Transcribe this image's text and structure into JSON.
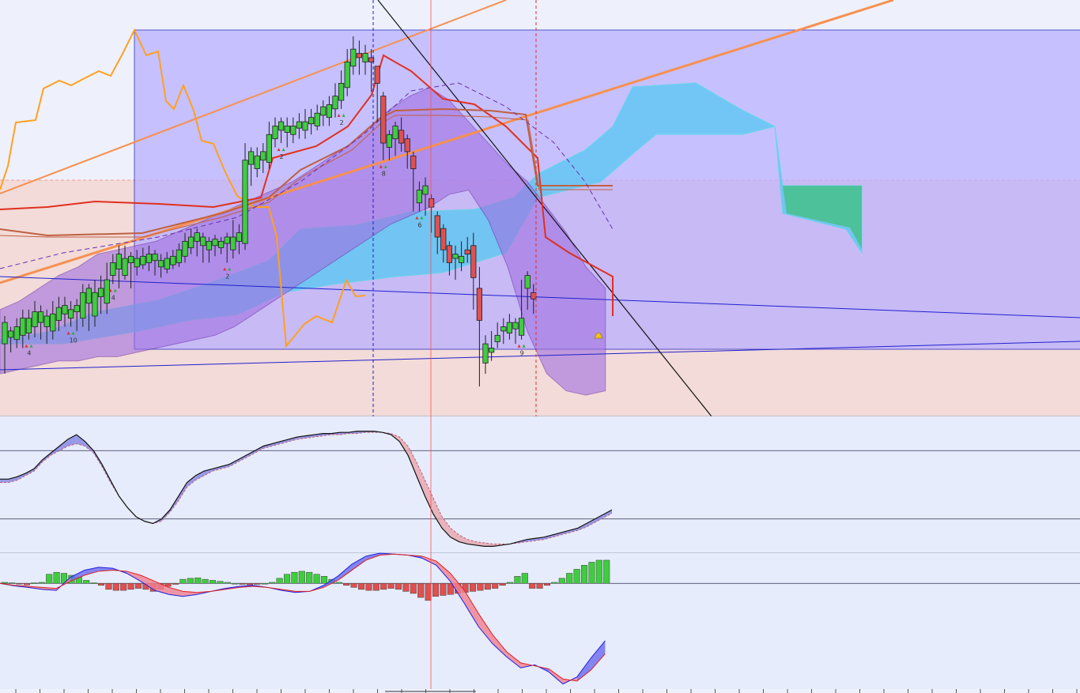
{
  "chart_data": [
    {
      "type": "candlestick",
      "panel": "price",
      "candles": [
        [
          314,
          324,
          317,
          327,
          300
        ],
        [
          317,
          320,
          316,
          322,
          310
        ],
        [
          316,
          322,
          318,
          326,
          312
        ],
        [
          318,
          326,
          319,
          330,
          312
        ],
        [
          319,
          326,
          322,
          330,
          316
        ],
        [
          322,
          329,
          324,
          334,
          317
        ],
        [
          324,
          329,
          322,
          332,
          316
        ],
        [
          322,
          327,
          320,
          330,
          314
        ],
        [
          320,
          328,
          325,
          334,
          316
        ],
        [
          325,
          331,
          328,
          336,
          320
        ],
        [
          328,
          332,
          326,
          336,
          322
        ],
        [
          326,
          330,
          329,
          334,
          322
        ],
        [
          329,
          332,
          326,
          335,
          320
        ],
        [
          326,
          338,
          333,
          342,
          322
        ],
        [
          333,
          340,
          327,
          342,
          320
        ],
        [
          327,
          338,
          336,
          344,
          322
        ],
        [
          336,
          340,
          333,
          346,
          328
        ],
        [
          333,
          344,
          346,
          352,
          328
        ],
        [
          346,
          352,
          349,
          356,
          342
        ],
        [
          349,
          356,
          346,
          360,
          340
        ],
        [
          346,
          354,
          352,
          360,
          344
        ],
        [
          352,
          355,
          350,
          357,
          340
        ],
        [
          350,
          354,
          351,
          358,
          346
        ],
        [
          351,
          355,
          352,
          359,
          349
        ],
        [
          352,
          356,
          353,
          360,
          348
        ],
        [
          353,
          356,
          350,
          358,
          346
        ],
        [
          350,
          353,
          349,
          356,
          345
        ],
        [
          349,
          354,
          351,
          357,
          347
        ],
        [
          351,
          355,
          352,
          358,
          349
        ],
        [
          352,
          358,
          355,
          361,
          350
        ],
        [
          355,
          362,
          359,
          366,
          352
        ],
        [
          359,
          364,
          362,
          368,
          356
        ],
        [
          362,
          366,
          360,
          368,
          355
        ],
        [
          360,
          364,
          358,
          366,
          352
        ],
        [
          358,
          362,
          360,
          364,
          352
        ],
        [
          360,
          363,
          359,
          365,
          355
        ],
        [
          359,
          362,
          361,
          364,
          356
        ],
        [
          361,
          364,
          358,
          366,
          352
        ],
        [
          358,
          364,
          362,
          372,
          354
        ],
        [
          362,
          366,
          361,
          370,
          356
        ],
        [
          361,
          400,
          398,
          408,
          358
        ],
        [
          398,
          404,
          396,
          406,
          388
        ],
        [
          396,
          402,
          400,
          406,
          392
        ],
        [
          400,
          404,
          399,
          408,
          394
        ],
        [
          399,
          412,
          410,
          418,
          396
        ],
        [
          410,
          416,
          414,
          420,
          406
        ],
        [
          414,
          418,
          413,
          420,
          408
        ],
        [
          413,
          416,
          412,
          420,
          406
        ],
        [
          412,
          416,
          415,
          420,
          408
        ],
        [
          415,
          418,
          414,
          422,
          410
        ],
        [
          414,
          418,
          417,
          424,
          410
        ],
        [
          417,
          420,
          416,
          424,
          412
        ],
        [
          416,
          422,
          421,
          426,
          414
        ],
        [
          421,
          425,
          420,
          428,
          416
        ],
        [
          420,
          426,
          424,
          430,
          416
        ],
        [
          424,
          430,
          428,
          436,
          420
        ],
        [
          428,
          436,
          434,
          442,
          424
        ],
        [
          434,
          446,
          444,
          452,
          430
        ],
        [
          444,
          452,
          450,
          458,
          440
        ],
        [
          450,
          448,
          446,
          456,
          440
        ],
        [
          446,
          450,
          448,
          454,
          440
        ],
        [
          448,
          446,
          444,
          452,
          432
        ],
        [
          444,
          436,
          430,
          440,
          418
        ],
        [
          430,
          408,
          406,
          432,
          400
        ],
        [
          406,
          412,
          410,
          414,
          400
        ],
        [
          410,
          416,
          414,
          418,
          402
        ],
        [
          414,
          408,
          410,
          420,
          404
        ],
        [
          410,
          404,
          402,
          412,
          396
        ],
        [
          402,
          396,
          380,
          404,
          376
        ],
        [
          380,
          386,
          384,
          390,
          376
        ],
        [
          384,
          388,
          382,
          392,
          374
        ],
        [
          382,
          378,
          374,
          384,
          366
        ],
        [
          374,
          364,
          368,
          376,
          356
        ],
        [
          368,
          358,
          360,
          370,
          352
        ],
        [
          360,
          352,
          354,
          362,
          346
        ],
        [
          354,
          356,
          352,
          360,
          344
        ],
        [
          352,
          355,
          358,
          362,
          348
        ],
        [
          358,
          356,
          360,
          364,
          352
        ],
        [
          360,
          345,
          340,
          366,
          330
        ],
        [
          340,
          325,
          305,
          350,
          294
        ],
        [
          305,
          314,
          310,
          318,
          300
        ],
        [
          310,
          312,
          315,
          320,
          306
        ],
        [
          315,
          318,
          320,
          324,
          312
        ],
        [
          320,
          322,
          319,
          326,
          314
        ],
        [
          319,
          324,
          321,
          328,
          316
        ],
        [
          321,
          324,
          318,
          326,
          314
        ],
        [
          318,
          326,
          340,
          344,
          316
        ],
        [
          340,
          346,
          338,
          348,
          330
        ],
        [
          338,
          335,
          332,
          342,
          328
        ]
      ],
      "x_start": 0,
      "x_step": 7.6,
      "ylim": [
        280,
        475
      ],
      "bollinger": {
        "upper": [
          330,
          334,
          340,
          346,
          350,
          356,
          358,
          360,
          362,
          366,
          370,
          374,
          378,
          382,
          386,
          390,
          396,
          402,
          408,
          416,
          424,
          430,
          434,
          428,
          418,
          408,
          398,
          390,
          378,
          366,
          350,
          340
        ],
        "lower": [
          300,
          302,
          304,
          306,
          306,
          308,
          308,
          310,
          312,
          314,
          316,
          318,
          322,
          328,
          334,
          340,
          346,
          352,
          358,
          364,
          370,
          374,
          378,
          384,
          386,
          372,
          350,
          320,
          300,
          292,
          290,
          292
        ],
        "x_step": 24.7
      },
      "fill_area_colors": [
        "#b9b0ff",
        "#a070e0",
        "#4fc9f2",
        "#30c050"
      ],
      "colors": {
        "up": "#3fcd3f",
        "down": "#e05050",
        "ma_red": "#e03020",
        "ma_brown": "#c06040",
        "price_orange": "#ffa020",
        "trend_orange": "#f79050",
        "rect": "#8080ff",
        "trendline_blue": "#2020d0"
      },
      "markers": [
        {
          "label": "2",
          "i": 46
        },
        {
          "label": "2",
          "i": 56
        },
        {
          "label": "8",
          "i": 63
        },
        {
          "label": "6",
          "i": 69
        },
        {
          "label": "4",
          "i": 18
        },
        {
          "label": "4",
          "i": 4
        },
        {
          "label": "10",
          "i": 11
        },
        {
          "label": "2",
          "i": 37
        },
        {
          "label": "9",
          "i": 86
        }
      ]
    },
    {
      "type": "line",
      "panel": "oscillator",
      "series": [
        {
          "values": [
            55,
            55,
            57,
            60,
            64,
            72,
            78,
            84,
            90,
            94,
            88,
            80,
            68,
            54,
            40,
            30,
            22,
            18,
            16,
            20,
            28,
            40,
            52,
            58,
            62,
            64,
            66,
            68,
            72,
            76,
            80,
            84,
            86,
            88,
            90,
            92,
            93,
            94,
            95,
            95,
            96,
            96,
            97,
            97,
            97,
            96,
            94,
            88,
            76,
            58,
            40,
            24,
            12,
            4,
            0,
            -2,
            -3,
            -4,
            -4,
            -3,
            -2,
            0,
            2,
            3,
            4,
            6,
            8,
            10,
            12,
            16,
            20,
            24,
            28
          ]
        },
        {
          "values": [
            52,
            52,
            54,
            58,
            62,
            70,
            76,
            80,
            84,
            86,
            84,
            78,
            66,
            52,
            40,
            30,
            22,
            18,
            16,
            18,
            26,
            36,
            48,
            54,
            58,
            62,
            64,
            66,
            70,
            74,
            78,
            82,
            84,
            86,
            88,
            90,
            91,
            92,
            93,
            94,
            94,
            95,
            95,
            96,
            96,
            96,
            95,
            92,
            84,
            70,
            54,
            38,
            22,
            12,
            6,
            2,
            0,
            -1,
            -2,
            -2,
            -2,
            -1,
            0,
            1,
            2,
            4,
            6,
            8,
            10,
            13,
            17,
            21,
            25
          ]
        }
      ],
      "ylim": [
        -10,
        110
      ],
      "levels": [
        80,
        20
      ]
    },
    {
      "type": "bar",
      "panel": "macd",
      "values": [
        0.2,
        0.1,
        -0.1,
        -0.3,
        0.1,
        0.2,
        1.8,
        2.2,
        2.0,
        1.6,
        1.2,
        0.6,
        0.1,
        -0.4,
        -1.2,
        -1.4,
        -1.4,
        -1.2,
        -1.0,
        -1.2,
        -1.6,
        -1.2,
        -0.6,
        -0.2,
        0.8,
        1.0,
        1.1,
        0.8,
        0.6,
        0.4,
        0.2,
        0.0,
        -0.2,
        -0.3,
        -0.2,
        0.0,
        0.2,
        1.0,
        1.8,
        2.2,
        2.4,
        2.2,
        1.8,
        1.4,
        0.8,
        0.2,
        -0.4,
        -0.8,
        -1.2,
        -1.4,
        -1.4,
        -1.2,
        -1.0,
        -1.2,
        -1.6,
        -2.0,
        -2.8,
        -3.4,
        -2.6,
        -2.4,
        -2.2,
        -2.0,
        -1.8,
        -1.6,
        -1.4,
        -1.2,
        -1.0,
        -0.4,
        0.2,
        1.4,
        2.0,
        -1.0,
        -1.0,
        -0.4,
        0.2,
        1.0,
        2.0,
        2.8,
        3.6,
        4.2,
        4.6,
        4.6
      ],
      "lines": {
        "macd": [
          0,
          -0.5,
          -0.8,
          -1.2,
          -1.4,
          1.2,
          2.6,
          3.2,
          3.0,
          2.0,
          0.4,
          -1.4,
          -2.2,
          -2.6,
          -2.2,
          -1.6,
          -1.0,
          -0.6,
          -0.4,
          -0.8,
          -1.4,
          -1.8,
          -1.6,
          -0.4,
          1.4,
          3.8,
          5.4,
          6.0,
          5.8,
          5.6,
          5.0,
          3.6,
          0.4,
          -4.0,
          -8.6,
          -12.0,
          -14.6,
          -16.8,
          -16.2,
          -17.6,
          -20.0,
          -18.6,
          -14.8,
          -11.4
        ],
        "signal": [
          0,
          -0.4,
          -0.6,
          -0.8,
          -1.0,
          0.4,
          1.6,
          2.4,
          2.6,
          2.4,
          1.6,
          0.4,
          -0.8,
          -1.6,
          -1.8,
          -1.6,
          -1.2,
          -0.8,
          -0.6,
          -0.8,
          -1.2,
          -1.6,
          -1.6,
          -0.8,
          0.6,
          2.6,
          4.6,
          5.6,
          5.8,
          5.6,
          5.4,
          4.4,
          2.0,
          -1.4,
          -6.0,
          -10.2,
          -13.6,
          -15.8,
          -16.4,
          -17.0,
          -19.0,
          -19.4,
          -17.2,
          -14.0
        ]
      },
      "ylim": [
        -21,
        6
      ]
    }
  ]
}
